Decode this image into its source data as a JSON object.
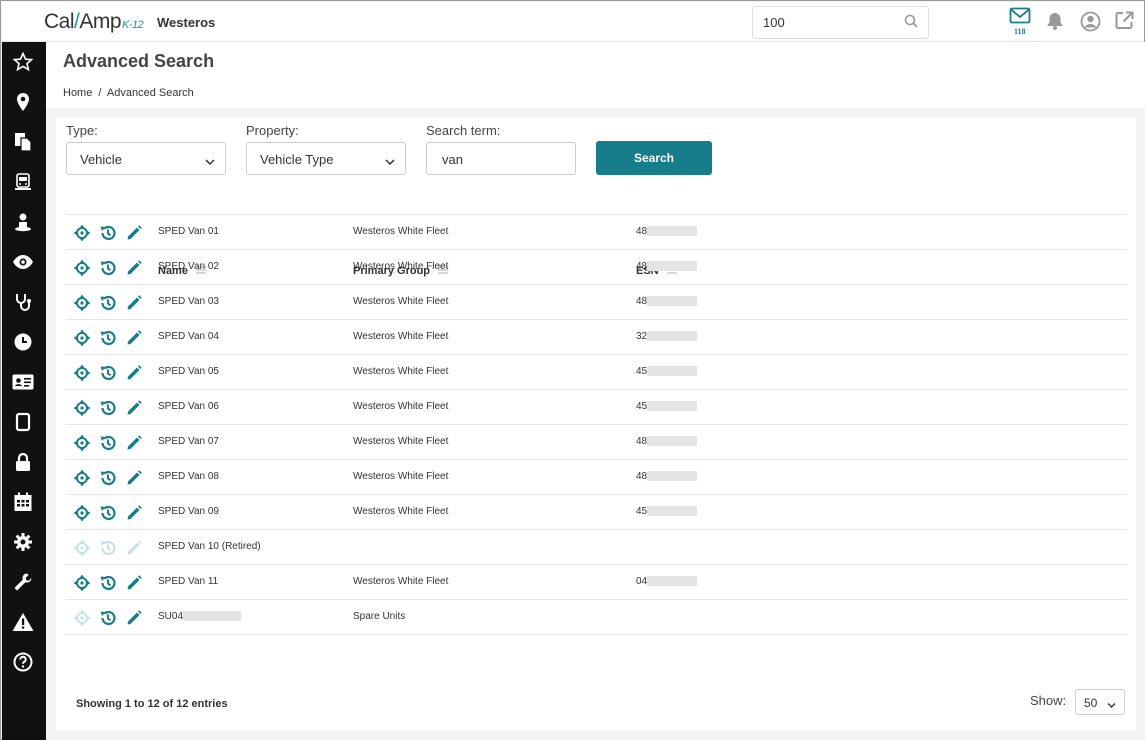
{
  "topbar": {
    "logo_text": "Cal",
    "logo_text2": "Amp",
    "logo_suffix": "K-12",
    "tenant": "Westeros",
    "search_value": "100",
    "mail_count": "118"
  },
  "sidebar": {
    "items": [
      "star-icon",
      "map-pin-icon",
      "documents-icon",
      "bus-icon",
      "driver-icon",
      "eye-icon",
      "stethoscope-icon",
      "clock-icon",
      "id-card-icon",
      "tablet-icon",
      "lock-icon",
      "calendar-icon",
      "gear-icon",
      "wrench-icon",
      "warning-icon",
      "help-icon"
    ]
  },
  "page": {
    "title": "Advanced Search",
    "breadcrumb_home": "Home",
    "breadcrumb_sep": "/",
    "breadcrumb_current": "Advanced Search"
  },
  "filters": {
    "type_label": "Type:",
    "type_value": "Vehicle",
    "property_label": "Property:",
    "property_value": "Vehicle Type",
    "term_label": "Search term:",
    "term_value": "van",
    "search_button": "Search"
  },
  "table": {
    "columns": [
      "Name",
      "Primary Group",
      "ESN"
    ],
    "rows": [
      {
        "name": "SPED Van 01",
        "group": "Westeros White Fleet",
        "esn": "48",
        "disabled": false
      },
      {
        "name": "SPED Van 02",
        "group": "Westeros White Fleet",
        "esn": "48",
        "disabled": false
      },
      {
        "name": "SPED Van 03",
        "group": "Westeros White Fleet",
        "esn": "48",
        "disabled": false
      },
      {
        "name": "SPED Van 04",
        "group": "Westeros White Fleet",
        "esn": "32",
        "disabled": false
      },
      {
        "name": "SPED Van 05",
        "group": "Westeros White Fleet",
        "esn": "45",
        "disabled": false
      },
      {
        "name": "SPED Van 06",
        "group": "Westeros White Fleet",
        "esn": "45",
        "disabled": false
      },
      {
        "name": "SPED Van 07",
        "group": "Westeros White Fleet",
        "esn": "48",
        "disabled": false
      },
      {
        "name": "SPED Van 08",
        "group": "Westeros White Fleet",
        "esn": "48",
        "disabled": false
      },
      {
        "name": "SPED Van 09",
        "group": "Westeros White Fleet",
        "esn": "45",
        "disabled": false
      },
      {
        "name": "SPED Van 10 (Retired)",
        "group": "",
        "esn": "",
        "disabled": true
      },
      {
        "name": "SPED Van 11",
        "group": "Westeros White Fleet",
        "esn": "04",
        "disabled": false
      },
      {
        "name": "SU04",
        "group": "Spare Units",
        "esn": "",
        "disabled": false,
        "locate_disabled": true
      }
    ]
  },
  "footer": {
    "showing": "Showing 1 to 12 of 12 entries",
    "show_label": "Show:",
    "show_value": "50"
  },
  "colors": {
    "accent": "#177d8b",
    "sidebar_bg": "#111111"
  }
}
